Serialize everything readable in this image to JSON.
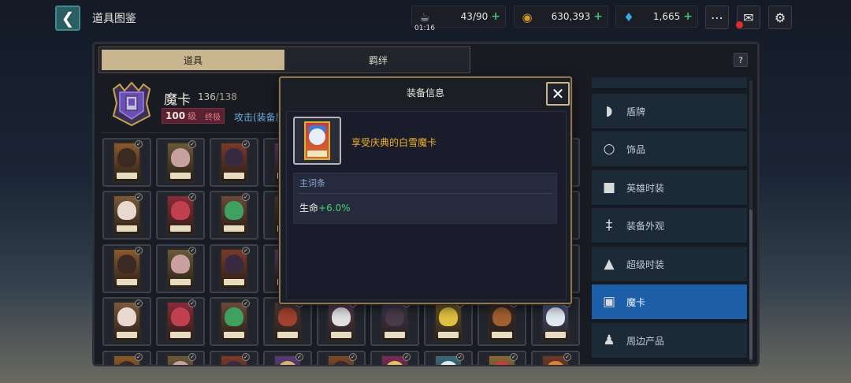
{
  "topbar": {
    "back_icon": "chevron-left-icon",
    "title": "道具图鉴",
    "resources": [
      {
        "icon": "coffee-cup-icon",
        "value": "43/90",
        "plus": "+",
        "timer": "01:16"
      },
      {
        "icon": "gold-coin-icon",
        "value": "630,393",
        "plus": "+"
      },
      {
        "icon": "diamond-icon",
        "value": "1,665",
        "plus": "+"
      }
    ],
    "icons": [
      "chat-icon",
      "mail-icon",
      "settings-icon"
    ]
  },
  "tabs": [
    {
      "label": "道具",
      "active": true
    },
    {
      "label": "羁绊",
      "active": false
    }
  ],
  "help_label": "?",
  "header": {
    "name": "魔卡",
    "count_current": "136",
    "count_total": "/138",
    "level_num": "100",
    "level_unit": "级",
    "level_max": "终极",
    "attack_text": "攻击(装备魔"
  },
  "sidenav": [
    {
      "icon": "sword-icon",
      "label": "",
      "active": false
    },
    {
      "icon": "shield-icon",
      "label": "盾牌",
      "active": false
    },
    {
      "icon": "ring-icon",
      "label": "饰品",
      "active": false
    },
    {
      "icon": "shirt-icon",
      "label": "英雄时装",
      "active": false
    },
    {
      "icon": "sword-skin-icon",
      "label": "装备外观",
      "active": false
    },
    {
      "icon": "suit-icon",
      "label": "超级时装",
      "active": false
    },
    {
      "icon": "card-icon",
      "label": "魔卡",
      "active": true
    },
    {
      "icon": "figure-icon",
      "label": "周边产品",
      "active": false
    }
  ],
  "modal": {
    "title": "装备信息",
    "close_icon": "close-icon",
    "item_name": "享受庆典的白雪魔卡",
    "stat_header": "主词条",
    "stat_label": "生命",
    "stat_value": "+6.0%"
  },
  "colors": {
    "accent_gold": "#f0b32d",
    "stat_green": "#48d26a",
    "nav_active": "#1c5fa8",
    "modal_border": "#8a7656"
  }
}
